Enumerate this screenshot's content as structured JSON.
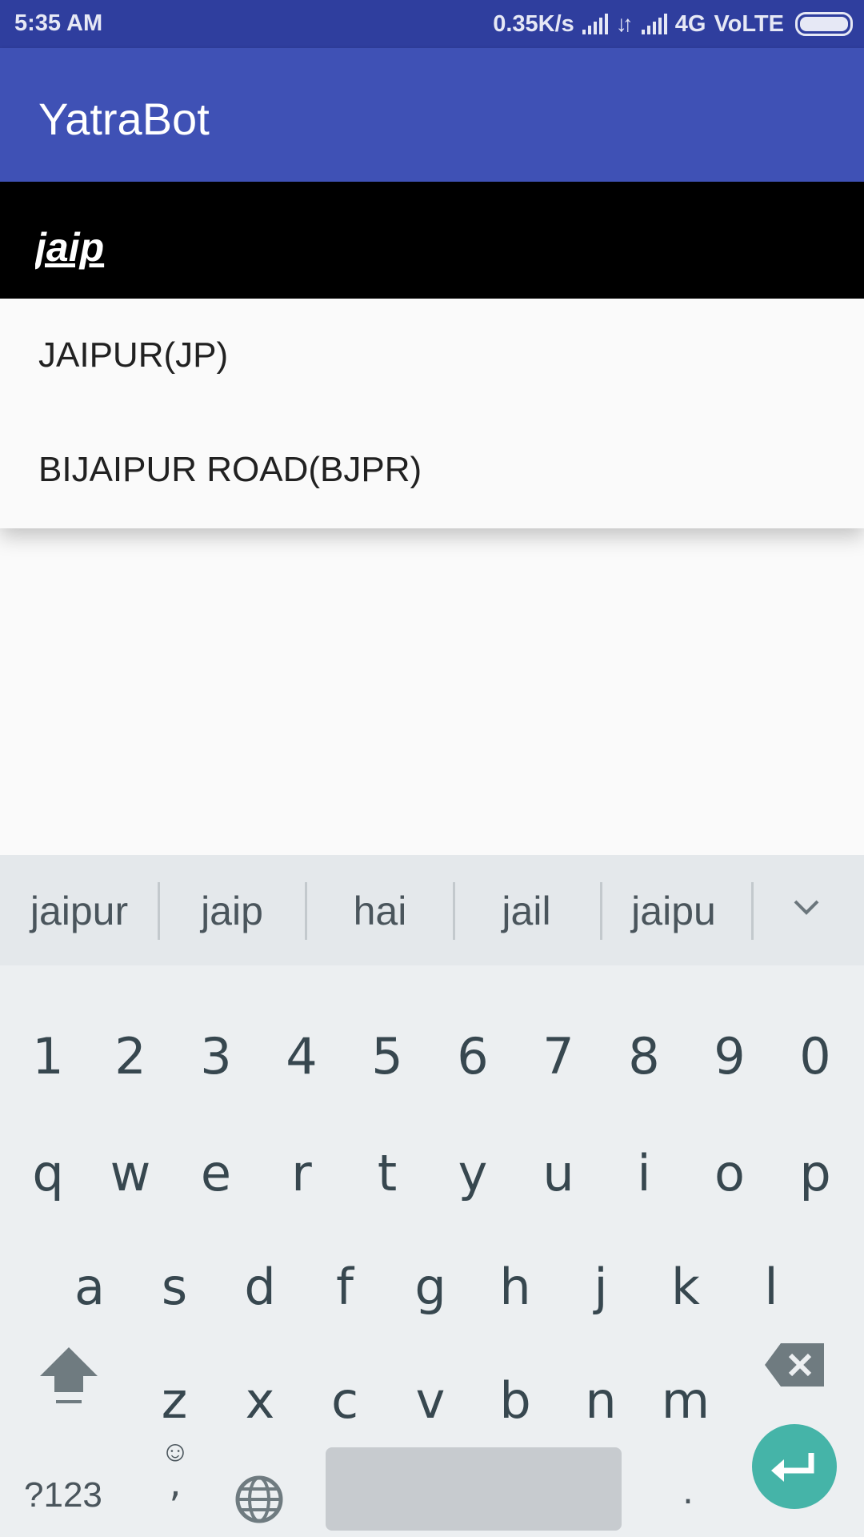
{
  "status_bar": {
    "time": "5:35 AM",
    "net_speed": "0.35K/s",
    "network_type": "4G",
    "volte": "VoLTE"
  },
  "app_bar": {
    "title": "YatraBot"
  },
  "search": {
    "value": "jaip"
  },
  "suggestions_dropdown": {
    "items": [
      {
        "label": "JAIPUR(JP)"
      },
      {
        "label": "BIJAIPUR ROAD(BJPR)"
      }
    ]
  },
  "keyboard": {
    "suggestions": [
      "jaipur",
      "jaip",
      "hai",
      "jail",
      "jaipu"
    ],
    "row_numbers": [
      "1",
      "2",
      "3",
      "4",
      "5",
      "6",
      "7",
      "8",
      "9",
      "0"
    ],
    "row_top": [
      "q",
      "w",
      "e",
      "r",
      "t",
      "y",
      "u",
      "i",
      "o",
      "p"
    ],
    "row_middle": [
      "a",
      "s",
      "d",
      "f",
      "g",
      "h",
      "j",
      "k",
      "l"
    ],
    "row_bottom": [
      "z",
      "x",
      "c",
      "v",
      "b",
      "n",
      "m"
    ],
    "symbols_label": "?123",
    "emoji_label": "☺",
    "comma_label": ",",
    "period_label": ".",
    "icons": {
      "collapse": "chevron-down-icon",
      "shift": "shift-arrow-icon",
      "backspace": "backspace-icon",
      "language": "globe-icon",
      "enter": "enter-arrow-icon"
    },
    "colors": {
      "enter_button": "#45b4a8",
      "app_bar": "#3f51b5",
      "status_bar": "#2f3e9e"
    }
  }
}
